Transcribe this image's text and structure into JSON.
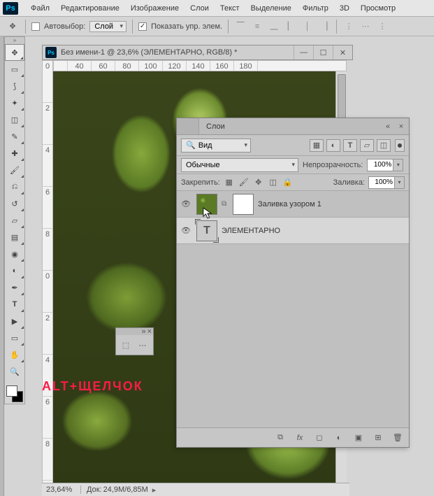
{
  "menu": {
    "items": [
      "Файл",
      "Редактирование",
      "Изображение",
      "Слои",
      "Текст",
      "Выделение",
      "Фильтр",
      "3D",
      "Просмотр"
    ]
  },
  "options_bar": {
    "autoselect_label": "Автовыбор:",
    "autoselect_checked": false,
    "target_select": "Слой",
    "show_controls_label": "Показать упр. элем.",
    "show_controls_checked": true
  },
  "document": {
    "title": "Без имени-1 @ 23,6% (ЭЛЕМЕНТАРНО, RGB/8) *",
    "ruler_h": [
      "40",
      "60",
      "80",
      "100",
      "120",
      "140",
      "160",
      "180"
    ],
    "ruler_v": [
      "0",
      "2",
      "4",
      "6",
      "8",
      "0",
      "2",
      "4",
      "6",
      "8"
    ]
  },
  "overlay_text": "ALT+ЩЕЛЧОК",
  "status": {
    "zoom": "23,64%",
    "doc_label": "Док:",
    "doc_value": "24,9M/6,85M"
  },
  "layers_panel": {
    "title": "Слои",
    "filter_label": "Вид",
    "blend_mode": "Обычные",
    "opacity_label": "Непрозрачность:",
    "opacity_value": "100%",
    "lock_label": "Закрепить:",
    "fill_label": "Заливка:",
    "fill_value": "100%",
    "layers": [
      {
        "name": "Заливка узором 1",
        "type": "pattern",
        "visible": true,
        "has_mask": true
      },
      {
        "name": "ЭЛЕМЕНТАРНО",
        "type": "text",
        "visible": true,
        "has_mask": false,
        "selected": true
      }
    ]
  }
}
